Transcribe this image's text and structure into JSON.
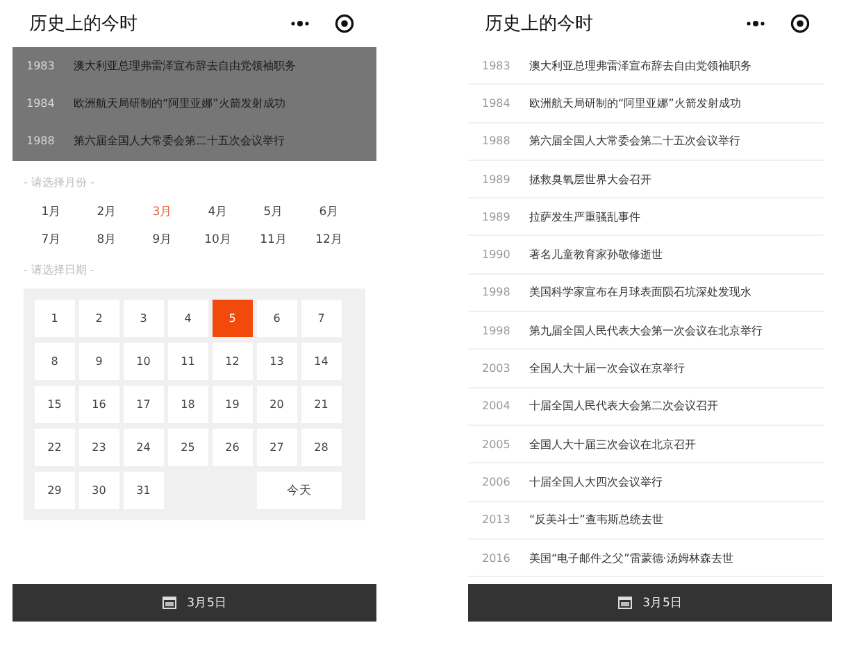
{
  "screens": [
    {
      "title": "历史上的今时",
      "events_dimmed": true,
      "events": [
        {
          "year": "1983",
          "text": "澳大利亚总理弗雷泽宣布辞去自由党领袖职务"
        },
        {
          "year": "1984",
          "text": "欧洲航天局研制的“阿里亚娜”火箭发射成功"
        },
        {
          "year": "1988",
          "text": "第六届全国人大常委会第二十五次会议举行"
        }
      ],
      "month_label": "- 请选择月份 -",
      "months": [
        {
          "label": "1月",
          "selected": false
        },
        {
          "label": "2月",
          "selected": false
        },
        {
          "label": "3月",
          "selected": true
        },
        {
          "label": "4月",
          "selected": false
        },
        {
          "label": "5月",
          "selected": false
        },
        {
          "label": "6月",
          "selected": false
        },
        {
          "label": "7月",
          "selected": false
        },
        {
          "label": "8月",
          "selected": false
        },
        {
          "label": "9月",
          "selected": false
        },
        {
          "label": "10月",
          "selected": false
        },
        {
          "label": "11月",
          "selected": false
        },
        {
          "label": "12月",
          "selected": false
        }
      ],
      "day_label": "- 请选择日期 -",
      "days": [
        {
          "label": "1",
          "selected": false
        },
        {
          "label": "2",
          "selected": false
        },
        {
          "label": "3",
          "selected": false
        },
        {
          "label": "4",
          "selected": false
        },
        {
          "label": "5",
          "selected": true
        },
        {
          "label": "6",
          "selected": false
        },
        {
          "label": "7",
          "selected": false
        },
        {
          "label": "8",
          "selected": false
        },
        {
          "label": "9",
          "selected": false
        },
        {
          "label": "10",
          "selected": false
        },
        {
          "label": "11",
          "selected": false
        },
        {
          "label": "12",
          "selected": false
        },
        {
          "label": "13",
          "selected": false
        },
        {
          "label": "14",
          "selected": false
        },
        {
          "label": "15",
          "selected": false
        },
        {
          "label": "16",
          "selected": false
        },
        {
          "label": "17",
          "selected": false
        },
        {
          "label": "18",
          "selected": false
        },
        {
          "label": "19",
          "selected": false
        },
        {
          "label": "20",
          "selected": false
        },
        {
          "label": "21",
          "selected": false
        },
        {
          "label": "22",
          "selected": false
        },
        {
          "label": "23",
          "selected": false
        },
        {
          "label": "24",
          "selected": false
        },
        {
          "label": "25",
          "selected": false
        },
        {
          "label": "26",
          "selected": false
        },
        {
          "label": "27",
          "selected": false
        },
        {
          "label": "28",
          "selected": false
        },
        {
          "label": "29",
          "selected": false
        },
        {
          "label": "30",
          "selected": false
        },
        {
          "label": "31",
          "selected": false
        }
      ],
      "today_button": "今天",
      "footer": "3月5日"
    },
    {
      "title": "历史上的今时",
      "events_dimmed": false,
      "events": [
        {
          "year": "1983",
          "text": "澳大利亚总理弗雷泽宣布辞去自由党领袖职务"
        },
        {
          "year": "1984",
          "text": "欧洲航天局研制的“阿里亚娜”火箭发射成功"
        },
        {
          "year": "1988",
          "text": "第六届全国人大常委会第二十五次会议举行"
        },
        {
          "year": "1989",
          "text": "拯救臭氧层世界大会召开"
        },
        {
          "year": "1989",
          "text": "拉萨发生严重骚乱事件"
        },
        {
          "year": "1990",
          "text": "著名儿童教育家孙敬修逝世"
        },
        {
          "year": "1998",
          "text": "美国科学家宣布在月球表面陨石坑深处发现水"
        },
        {
          "year": "1998",
          "text": "第九届全国人民代表大会第一次会议在北京举行"
        },
        {
          "year": "2003",
          "text": "全国人大十届一次会议在京举行"
        },
        {
          "year": "2004",
          "text": "十届全国人民代表大会第二次会议召开"
        },
        {
          "year": "2005",
          "text": "全国人大十届三次会议在北京召开"
        },
        {
          "year": "2006",
          "text": "十届全国人大四次会议举行"
        },
        {
          "year": "2013",
          "text": "“反美斗士”查韦斯总统去世"
        },
        {
          "year": "2016",
          "text": "美国“电子邮件之父”雷蒙德·汤姆林森去世"
        }
      ],
      "footer": "3月5日"
    }
  ]
}
